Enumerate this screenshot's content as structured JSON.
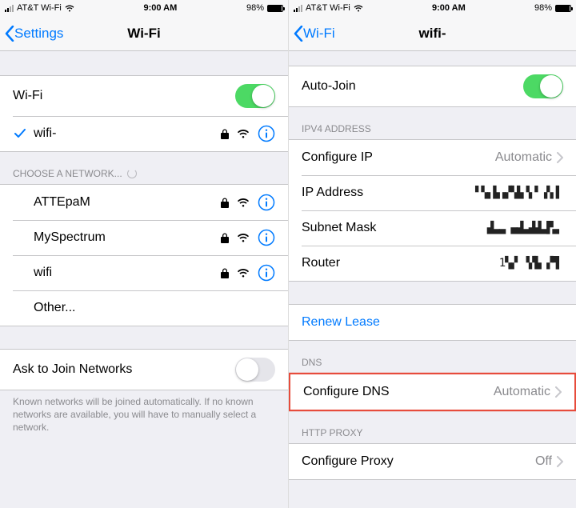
{
  "status": {
    "carrier": "AT&T Wi-Fi",
    "time": "9:00 AM",
    "battery": "98%"
  },
  "left": {
    "nav_back": "Settings",
    "nav_title": "Wi-Fi",
    "wifi_toggle_label": "Wi-Fi",
    "connected_network": "wifi-",
    "choose_header": "CHOOSE A NETWORK...",
    "networks": [
      "ATTEpaM",
      "MySpectrum",
      "wifi"
    ],
    "other_label": "Other...",
    "ask_join_label": "Ask to Join Networks",
    "ask_join_on": false,
    "footer": "Known networks will be joined automatically. If no known networks are available, you will have to manually select a network."
  },
  "right": {
    "nav_back": "Wi-Fi",
    "nav_title": "wifi-",
    "auto_join_label": "Auto-Join",
    "auto_join_on": true,
    "ipv4_header": "IPV4 ADDRESS",
    "configure_ip_label": "Configure IP",
    "configure_ip_value": "Automatic",
    "ip_address_label": "IP Address",
    "ip_address_value": "▘▚▖▙▗▞▚▙▝▖▘▗▚▐",
    "subnet_label": "Subnet Mask",
    "subnet_value": "▟▃▃ ▄▟▃▟▟▃▛▃",
    "router_label": "Router",
    "router_value": "1▚▞ ▝▞▙ ▞▜",
    "renew_lease": "Renew Lease",
    "dns_header": "DNS",
    "configure_dns_label": "Configure DNS",
    "configure_dns_value": "Automatic",
    "proxy_header": "HTTP PROXY",
    "configure_proxy_label": "Configure Proxy",
    "configure_proxy_value": "Off"
  }
}
